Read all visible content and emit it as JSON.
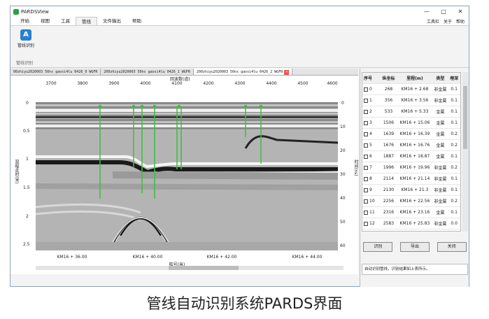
{
  "window": {
    "title": "PARDSView",
    "controls": [
      "—",
      "□",
      "✕"
    ]
  },
  "ribbon": {
    "tabs": [
      "开始",
      "视图",
      "工具",
      "管线",
      "文件输出",
      "帮助"
    ],
    "active_tab": "管线",
    "right_items": [
      "工具栏",
      "关于",
      "帮助"
    ],
    "tool": {
      "icon": "pipe-recognition-icon",
      "label": "管线识别"
    },
    "group_label": "管线识别"
  },
  "doc_tabs": [
    "00zhiyu2020003 50ns gaosi4lu 0426_0 WGFR",
    "200zhiyu2020003 50ns gaosi4lu 0426_1 WGFR",
    "200zhiyu2020003 50ns gaosi4lu 0426_2 WGFR"
  ],
  "plot": {
    "top_axis_title": "回波数(道)",
    "top_ticks": [
      "3700",
      "3800",
      "3900",
      "4000",
      "4100",
      "4200",
      "4300",
      "4400",
      "4500",
      "4600"
    ],
    "left_axis_title": "双程走时(米)",
    "left_ticks": [
      "0",
      "0.5",
      "1",
      "1.5",
      "2",
      "2.5"
    ],
    "right_axis_title": "时间(ns)",
    "right_ticks": [
      "0",
      "10",
      "20",
      "30",
      "40",
      "50",
      "60"
    ],
    "bottom_ticks": [
      "KM16 + 36.00",
      "KM16 + 40.00",
      "KM16 + 42.00",
      "KM16 + 44.00"
    ],
    "bottom_axis_title": "桩号(米)"
  },
  "table": {
    "headers": [
      "序号",
      "纵坐标",
      "里程(m)",
      "类型",
      "埋深"
    ],
    "rows": [
      [
        "0",
        "268",
        "KM16 + 2.68",
        "非金属",
        "0.1"
      ],
      [
        "1",
        "356",
        "KM16 + 3.56",
        "非金属",
        "0.1"
      ],
      [
        "2",
        "533",
        "KM16 + 5.33",
        "金属",
        "0.1"
      ],
      [
        "3",
        "1506",
        "KM16 + 15.06",
        "金属",
        "0.1"
      ],
      [
        "4",
        "1639",
        "KM16 + 16.39",
        "金属",
        "0.2"
      ],
      [
        "5",
        "1676",
        "KM16 + 16.76",
        "金属",
        "0.2"
      ],
      [
        "6",
        "1887",
        "KM16 + 18.87",
        "金属",
        "0.1"
      ],
      [
        "7",
        "1996",
        "KM16 + 19.96",
        "非金属",
        "0.2"
      ],
      [
        "8",
        "2114",
        "KM16 + 21.14",
        "非金属",
        "0.1"
      ],
      [
        "9",
        "2130",
        "KM16 + 21.3",
        "非金属",
        "0.1"
      ],
      [
        "10",
        "2256",
        "KM16 + 22.56",
        "非金属",
        "0.2"
      ],
      [
        "11",
        "2316",
        "KM16 + 23.16",
        "金属",
        "0.1"
      ],
      [
        "12",
        "2583",
        "KM16 + 25.83",
        "非金属",
        "0.0"
      ]
    ]
  },
  "buttons": {
    "identify": "识别",
    "export": "导出",
    "close": "关闭"
  },
  "status_text": "自动识别管线，识别结果如上表所示。",
  "caption": "管线自动识别系统PARDS界面"
}
